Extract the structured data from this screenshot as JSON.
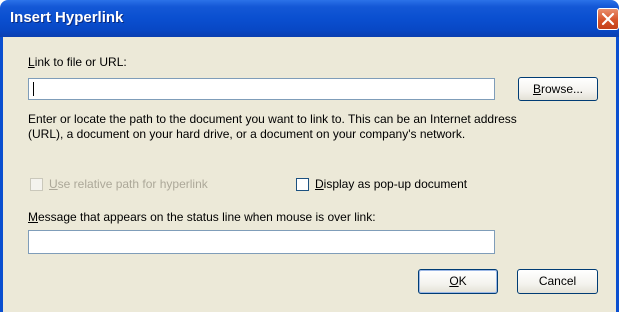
{
  "window": {
    "title": "Insert Hyperlink"
  },
  "link_label": "Link to file or URL:",
  "link_value": "",
  "browse_label": "Browse...",
  "description": [
    "Enter or locate the path to the document you want to link to. This can be an Internet address",
    "(URL), a document on your hard drive, or a document on your company's network."
  ],
  "relative_path_label": "Use relative path for hyperlink",
  "popup_label": "Display as pop-up document",
  "status_label": "Message that appears on the status line when mouse is over link:",
  "status_value": "",
  "ok_label": "OK",
  "cancel_label": "Cancel"
}
